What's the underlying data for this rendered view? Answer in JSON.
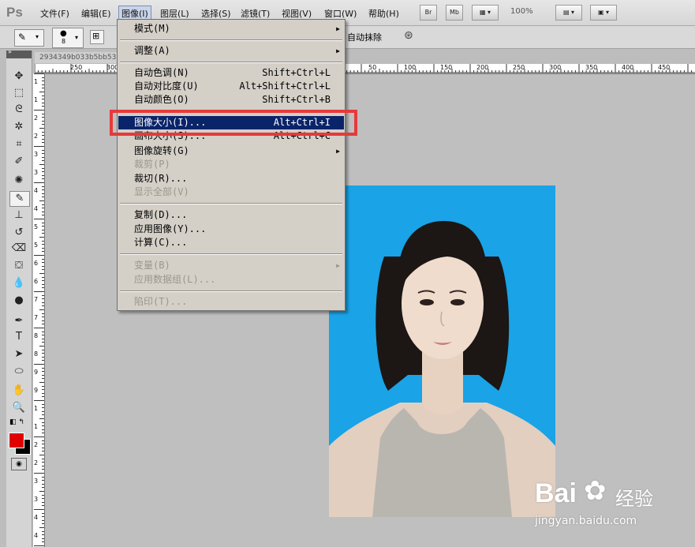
{
  "app": {
    "logo": "Ps",
    "doc_tab": "2934349b033b5bb53"
  },
  "menubar": {
    "items": [
      {
        "label": "文件(F)"
      },
      {
        "label": "编辑(E)"
      },
      {
        "label": "图像(I)"
      },
      {
        "label": "图层(L)"
      },
      {
        "label": "选择(S)"
      },
      {
        "label": "滤镜(T)"
      },
      {
        "label": "视图(V)"
      },
      {
        "label": "窗口(W)"
      },
      {
        "label": "帮助(H)"
      }
    ],
    "br": "Br",
    "mb": "Mb",
    "zoom": "100%"
  },
  "options": {
    "brush_size": "8",
    "auto_erase": "自动抹除"
  },
  "image_menu": {
    "items": [
      {
        "label": "模式(M)",
        "shortcut": "",
        "arrow": "▶",
        "disabled": false
      },
      {
        "label": "调整(A)",
        "shortcut": "",
        "arrow": "▶",
        "disabled": false
      },
      {
        "label": "自动色调(N)",
        "shortcut": "Shift+Ctrl+L",
        "arrow": "",
        "disabled": false
      },
      {
        "label": "自动对比度(U)",
        "shortcut": "Alt+Shift+Ctrl+L",
        "arrow": "",
        "disabled": false
      },
      {
        "label": "自动颜色(O)",
        "shortcut": "Shift+Ctrl+B",
        "arrow": "",
        "disabled": false
      },
      {
        "label": "图像大小(I)...",
        "shortcut": "Alt+Ctrl+I",
        "arrow": "",
        "disabled": false
      },
      {
        "label": "画布大小(S)...",
        "shortcut": "Alt+Ctrl+C",
        "arrow": "",
        "disabled": false
      },
      {
        "label": "图像旋转(G)",
        "shortcut": "",
        "arrow": "▶",
        "disabled": false
      },
      {
        "label": "裁剪(P)",
        "shortcut": "",
        "arrow": "",
        "disabled": true
      },
      {
        "label": "裁切(R)...",
        "shortcut": "",
        "arrow": "",
        "disabled": false
      },
      {
        "label": "显示全部(V)",
        "shortcut": "",
        "arrow": "",
        "disabled": true
      },
      {
        "label": "复制(D)...",
        "shortcut": "",
        "arrow": "",
        "disabled": false
      },
      {
        "label": "应用图像(Y)...",
        "shortcut": "",
        "arrow": "",
        "disabled": false
      },
      {
        "label": "计算(C)...",
        "shortcut": "",
        "arrow": "",
        "disabled": false
      },
      {
        "label": "变量(B)",
        "shortcut": "",
        "arrow": "▶",
        "disabled": true
      },
      {
        "label": "应用数据组(L)...",
        "shortcut": "",
        "arrow": "",
        "disabled": true
      },
      {
        "label": "陷印(T)...",
        "shortcut": "",
        "arrow": "",
        "disabled": true
      }
    ]
  },
  "ruler": {
    "h": [
      "250",
      "300",
      "50",
      "100",
      "150",
      "200",
      "250",
      "300",
      "350",
      "400",
      "450"
    ],
    "v": [
      "1",
      "1",
      "2",
      "2",
      "3",
      "3",
      "4",
      "4",
      "5",
      "5",
      "6",
      "6",
      "7",
      "7",
      "8",
      "8",
      "9",
      "9",
      "1",
      "1",
      "2",
      "2",
      "3",
      "3",
      "4",
      "4"
    ]
  },
  "watermark": {
    "brand": "Bai",
    "brand2": "经验",
    "url": "jingyan.baidu.com"
  },
  "colors": {
    "highlight": "#0a246a",
    "photo_bg": "#1aa3e6",
    "annotation": "#e8393a",
    "fg": "#e00000",
    "bg": "#000000"
  }
}
